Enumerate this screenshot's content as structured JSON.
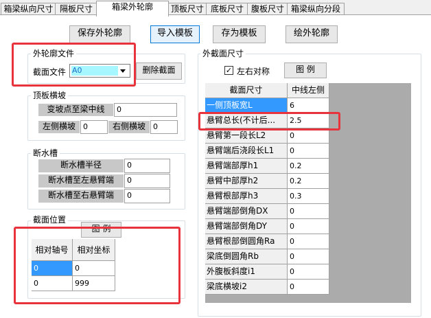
{
  "tabs": [
    "箱梁纵向尺寸",
    "隔板尺寸",
    "箱梁外轮廓",
    "顶板尺寸",
    "底板尺寸",
    "腹板尺寸",
    "箱梁纵向分段"
  ],
  "toolbar": {
    "save_outline": "保存外轮廓",
    "import_template": "导入模板",
    "save_as_template": "存为模板",
    "draw_outline": "绘外轮廓"
  },
  "outline_file": {
    "title": "外轮廓文件",
    "label": "截面文件",
    "value": "A0",
    "delete_button": "删除截面"
  },
  "top_slope": {
    "title": "顶板横坡",
    "slope_point_label": "变坡点至梁中线",
    "slope_point_value": "0",
    "left_label": "左侧横坡",
    "left_value": "0",
    "right_label": "右侧横坡",
    "right_value": "0"
  },
  "drip": {
    "title": "断水槽",
    "rows": [
      {
        "label": "断水槽半径",
        "value": "0"
      },
      {
        "label": "断水槽至左悬臂端",
        "value": "0"
      },
      {
        "label": "断水槽至右悬臂端",
        "value": "0"
      }
    ]
  },
  "section_pos": {
    "title": "截面位置",
    "legend_button": "图 例",
    "headers": [
      "相对轴号",
      "相对坐标"
    ],
    "rows": [
      [
        "0",
        "0"
      ],
      [
        "0",
        "999"
      ]
    ]
  },
  "outer_size": {
    "title": "外截面尺寸",
    "symmetric_label": "左右对称",
    "symmetric_checked": true,
    "legend_button": "图 例",
    "headers": [
      "截面尺寸",
      "中线左侧"
    ],
    "rows": [
      {
        "name": "一侧顶板宽L",
        "value": "6"
      },
      {
        "name": "悬臂总长(不计后...",
        "value": "2.5"
      },
      {
        "name": "悬臂第一段长L2",
        "value": "0"
      },
      {
        "name": "悬臂端后浇段长L1",
        "value": "0"
      },
      {
        "name": "悬臂端部厚h1",
        "value": "0.2"
      },
      {
        "name": "悬臂中部厚h2",
        "value": "0.2"
      },
      {
        "name": "悬臂根部厚h3",
        "value": "0.3"
      },
      {
        "name": "悬臂端部倒角DX",
        "value": "0"
      },
      {
        "name": "悬臂端部倒角DY",
        "value": "0"
      },
      {
        "name": "悬臂根部倒圆角Ra",
        "value": "0"
      },
      {
        "name": "梁底倒圆角Rb",
        "value": "0"
      },
      {
        "name": "外腹板斜度i1",
        "value": "0"
      },
      {
        "name": "梁底横坡i2",
        "value": "0"
      }
    ]
  },
  "colors": {
    "selection": "#3399ff",
    "highlight_red": "#e8323c",
    "combo_fill": "#a6f7ff"
  }
}
